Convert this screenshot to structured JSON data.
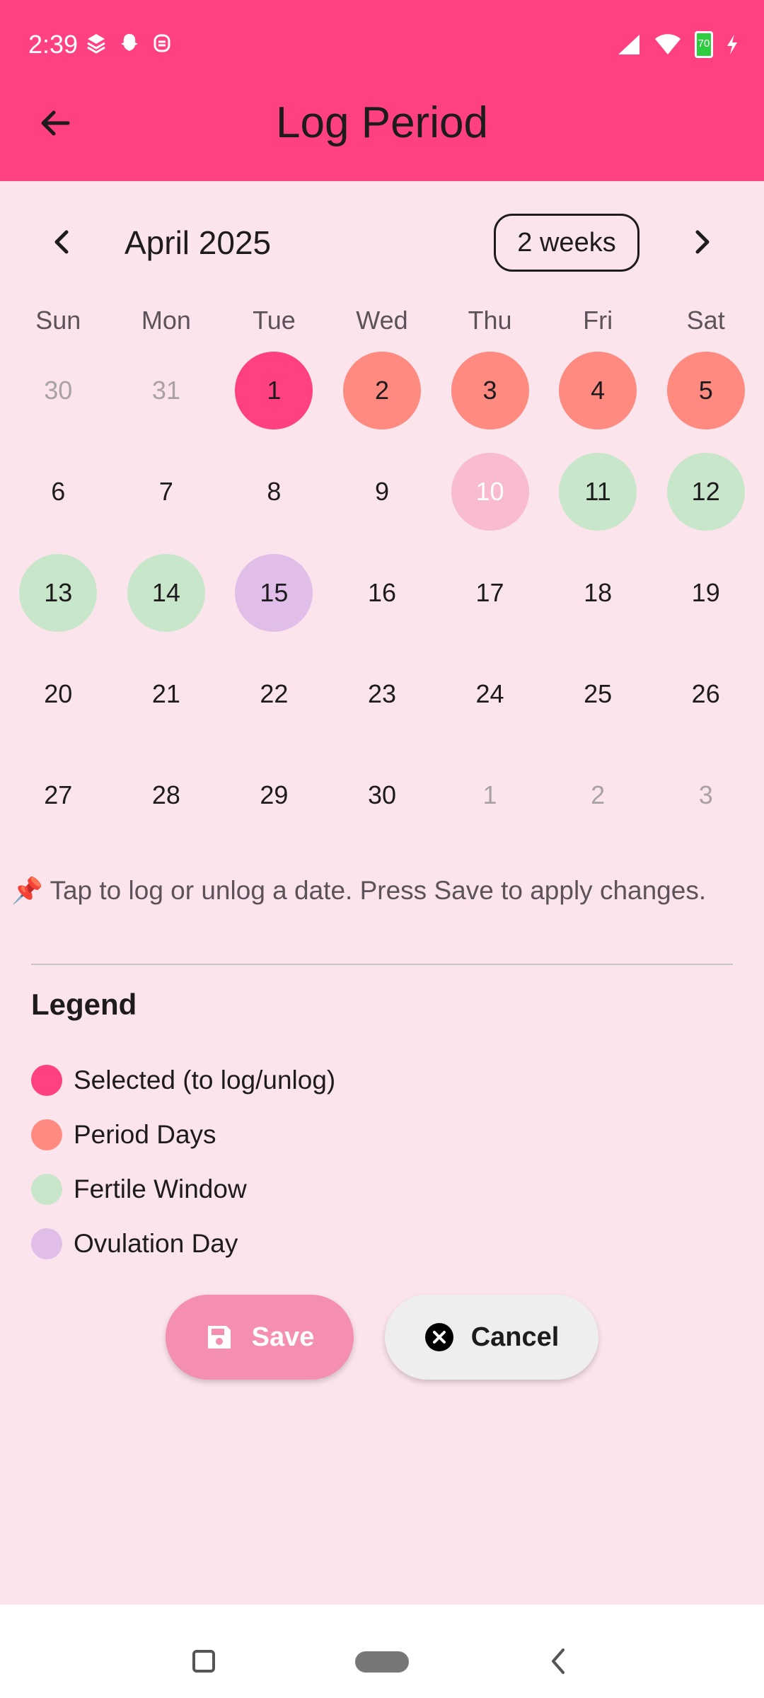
{
  "status_bar": {
    "time": "2:39",
    "battery": "70"
  },
  "app_bar": {
    "title": "Log Period"
  },
  "calendar": {
    "month_title": "April 2025",
    "format_button": "2 weeks",
    "weekdays": [
      "Sun",
      "Mon",
      "Tue",
      "Wed",
      "Thu",
      "Fri",
      "Sat"
    ],
    "days": [
      {
        "label": "30",
        "state": "outside"
      },
      {
        "label": "31",
        "state": "outside"
      },
      {
        "label": "1",
        "state": "selected"
      },
      {
        "label": "2",
        "state": "period"
      },
      {
        "label": "3",
        "state": "period"
      },
      {
        "label": "4",
        "state": "period"
      },
      {
        "label": "5",
        "state": "period"
      },
      {
        "label": "6",
        "state": "normal"
      },
      {
        "label": "7",
        "state": "normal"
      },
      {
        "label": "8",
        "state": "normal"
      },
      {
        "label": "9",
        "state": "normal"
      },
      {
        "label": "10",
        "state": "predicted"
      },
      {
        "label": "11",
        "state": "fertile"
      },
      {
        "label": "12",
        "state": "fertile"
      },
      {
        "label": "13",
        "state": "fertile"
      },
      {
        "label": "14",
        "state": "fertile"
      },
      {
        "label": "15",
        "state": "ovulation"
      },
      {
        "label": "16",
        "state": "normal"
      },
      {
        "label": "17",
        "state": "normal"
      },
      {
        "label": "18",
        "state": "normal"
      },
      {
        "label": "19",
        "state": "normal"
      },
      {
        "label": "20",
        "state": "normal"
      },
      {
        "label": "21",
        "state": "normal"
      },
      {
        "label": "22",
        "state": "normal"
      },
      {
        "label": "23",
        "state": "normal"
      },
      {
        "label": "24",
        "state": "normal"
      },
      {
        "label": "25",
        "state": "normal"
      },
      {
        "label": "26",
        "state": "normal"
      },
      {
        "label": "27",
        "state": "normal"
      },
      {
        "label": "28",
        "state": "normal"
      },
      {
        "label": "29",
        "state": "normal"
      },
      {
        "label": "30",
        "state": "normal"
      },
      {
        "label": "1",
        "state": "outside"
      },
      {
        "label": "2",
        "state": "outside"
      },
      {
        "label": "3",
        "state": "outside"
      }
    ]
  },
  "hint": {
    "icon": "📌",
    "text": "Tap to log or unlog a date. Press Save to apply changes."
  },
  "legend": {
    "title": "Legend",
    "items": [
      {
        "label": "Selected (to log/unlog)",
        "color": "#ff4081"
      },
      {
        "label": "Period Days",
        "color": "#ff8a80"
      },
      {
        "label": "Fertile Window",
        "color": "#c8e6c9"
      },
      {
        "label": "Ovulation Day",
        "color": "#e1bee7"
      }
    ]
  },
  "actions": {
    "save_label": "Save",
    "cancel_label": "Cancel"
  },
  "colors": {
    "app_bar": "#ff4081",
    "background": "#fce4ec",
    "save_button": "#f48fb1",
    "cancel_button": "#eeeeee"
  }
}
